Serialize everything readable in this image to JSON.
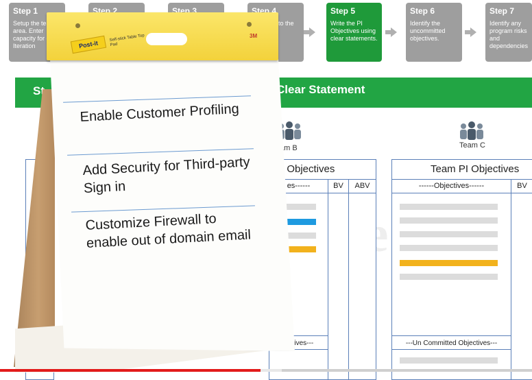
{
  "steps": [
    {
      "title": "Step 1",
      "desc": "Setup the team area. Enter capacity for each Iteration",
      "active": false
    },
    {
      "title": "Step 2",
      "desc": "",
      "active": false
    },
    {
      "title": "Step 3",
      "desc": "",
      "active": false
    },
    {
      "title": "Step 4",
      "desc": "into the s.",
      "active": false
    },
    {
      "title": "Step 5",
      "desc": "Write the PI Objectives using clear statements.",
      "active": true
    },
    {
      "title": "Step 6",
      "desc": "Identify the uncommitted objectives.",
      "active": false
    },
    {
      "title": "Step 7",
      "desc": "Identify any program risks and dependencies",
      "active": false
    }
  ],
  "banner": {
    "left_text": "St",
    "right_text": "Clear Statement"
  },
  "teams": {
    "team_b": "am B",
    "team_c": "Team C"
  },
  "table_b": {
    "title": "I Objectives",
    "objectives_header": "es------",
    "bv": "BV",
    "abv": "ABV",
    "uncommitted": "jectives---"
  },
  "table_c": {
    "title": "Team PI Objectives",
    "objectives_header": "------Objectives------",
    "bv": "BV",
    "uncommitted": "---Un Committed Objectives---"
  },
  "flipchart": {
    "brand": "Post-it",
    "sub_brand": "Self-stick Table Top Pad",
    "maker": "3M",
    "items": [
      "Enable Customer Profiling",
      "Add Security for Third-party Sign in",
      "Customize Firewall to enable out of domain email"
    ]
  },
  "video": {
    "progress": 0.49,
    "buffered": 0.53
  },
  "colors": {
    "active_step": "#1f9a3a",
    "step": "#9e9e9e",
    "banner": "#22a544",
    "table_border": "#5a7fb8",
    "progress": "#e21b1b"
  }
}
